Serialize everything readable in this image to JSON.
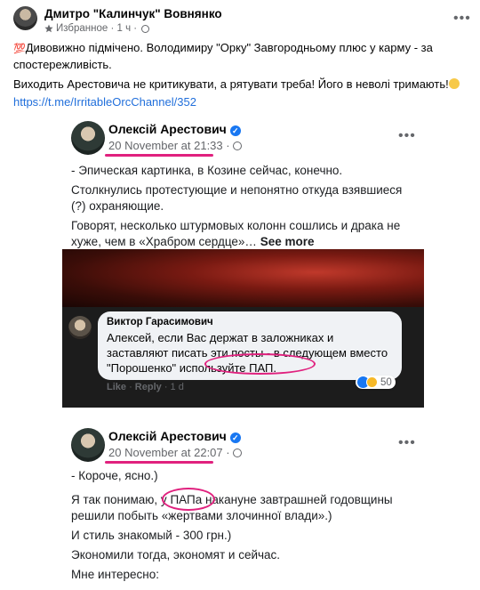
{
  "outer_post": {
    "author": "Дмитро \"Калинчук\" Вовнянко",
    "meta_label": "Избранное · 1 ч ·",
    "paragraph1_emoji": "💯",
    "paragraph1": "Дивовижно підмічено. Володимиру \"Орку\" Завгородньому плюс у карму - за спостережливість.",
    "paragraph2": "Виходить Арестовича не критикувати, а рятувати треба! Його в неволі тримають!",
    "link": "https://t.me/IrritableOrcChannel/352"
  },
  "embedded_post1": {
    "author": "Олексій Арестович",
    "time": "20 November at 21:33 ·",
    "line1": "- Эпическая картинка, в Козине сейчас, конечно.",
    "line2": "Столкнулись протестующие и непонятно откуда взявшиеся (?) охраняющие.",
    "line3": "Говорят, несколько штурмовых колонн сошлись и драка не хуже, чем в «Храбром сердце»…",
    "see_more": "See more"
  },
  "comment": {
    "author": "Виктор Гарасимович",
    "text_part1": "Алексей, если Вас держат в заложниках и заставляют писать эти посты - в следующем вместо \"Порошенко\" ",
    "text_circled": "используйте ПАП.",
    "like": "Like",
    "reply": "Reply",
    "age": "1 d",
    "reaction_count": "50"
  },
  "embedded_post2": {
    "author": "Олексій Арестович",
    "time": "20 November at 22:07 ·",
    "line1": "- Короче, ясно.)",
    "line2_before": "Я так понимаю, у ",
    "line2_circled": "ПАПа",
    "line2_after": " накануне завтрашней годовщины решили побыть «жертвами злочинної влади».)",
    "line3": "И стиль знакомый - 300 грн.)",
    "line4": "Экономили тогда, экономят и сейчас.",
    "line5": "Мне интересно:"
  },
  "colors": {
    "accent_link": "#216fdb",
    "marker": "#e0217e",
    "verified": "#1877f2"
  }
}
